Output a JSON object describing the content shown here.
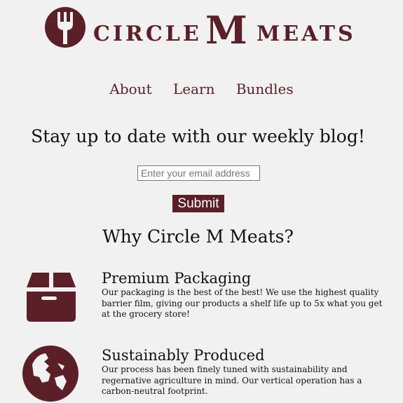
{
  "brand": {
    "name_part1": "CIRCLE",
    "name_part2": "M",
    "name_part3": "MEATS",
    "color": "#5a1f27"
  },
  "nav": {
    "items": [
      {
        "label": "About"
      },
      {
        "label": "Learn"
      },
      {
        "label": "Bundles"
      }
    ]
  },
  "blog": {
    "heading": "Stay up to date with our weekly blog!",
    "email_placeholder": "Enter your email address",
    "submit_label": "Submit"
  },
  "why": {
    "heading": "Why Circle M Meats?",
    "features": [
      {
        "icon": "box-icon",
        "title": "Premium Packaging",
        "description": "Our packaging is the best of the best! We use the highest quality barrier film, giving our products a shelf life up to 5x what you get at the grocery store!"
      },
      {
        "icon": "globe-icon",
        "title": "Sustainably Produced",
        "description": "Our process has been finely tuned with sustainability and regernative agriculture in mind. Our vertical operation has a carbon-neutral footprint."
      }
    ]
  }
}
